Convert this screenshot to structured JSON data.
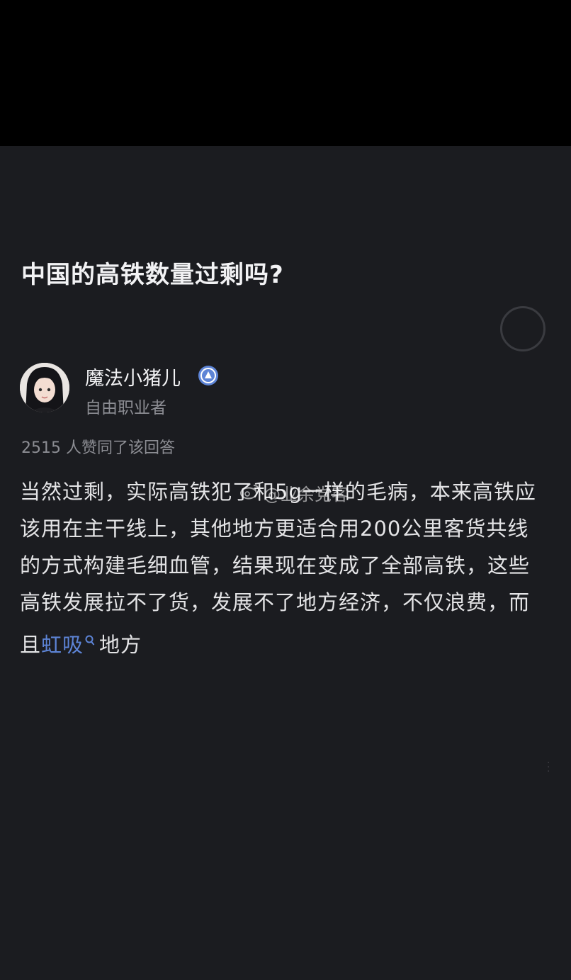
{
  "question": {
    "title": "中国的高铁数量过剩吗?"
  },
  "author": {
    "name": "魔法小猪儿",
    "title": "自由职业者"
  },
  "answer": {
    "vote_text": "2515 人赞同了该回答",
    "body_part1": "当然过剩，实际高铁犯了和5g一样的毛病，本来高铁应该用在主干线上，其他地方更适合用200公里客货共线的方式构建毛细血管，结果现在变成了全部高铁，这些高铁发展拉不了货，发展不了地方经济，不仅浪费，而且",
    "keyword": "虹吸",
    "body_part2": "地方"
  },
  "watermark": {
    "text": "@业余党客"
  },
  "colors": {
    "background": "#1b1c20",
    "top_bar": "#000000",
    "link": "#5d84d6",
    "verified": "#5d84d6"
  },
  "icons": {
    "verified": "verified-badge-icon",
    "search": "search-icon",
    "weibo": "weibo-icon",
    "more": "more-icon"
  }
}
